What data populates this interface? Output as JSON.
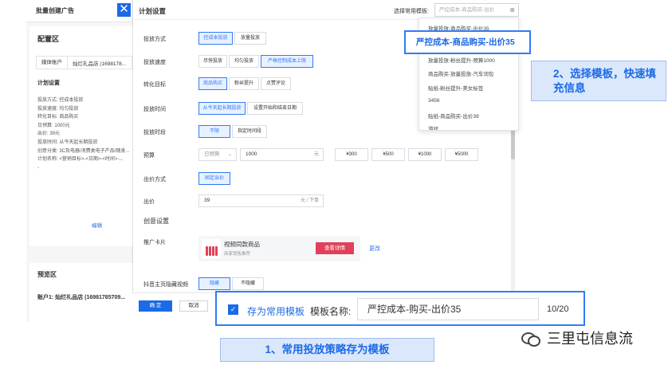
{
  "left_panel": {
    "header": "批量创建广告",
    "close_glyph": "✕",
    "config_title": "配置区",
    "account_tag": "媒体账户",
    "account_name": "灿烂礼品店 (1698178...",
    "plan_title": "计划设置",
    "plan_lines": [
      "投放方式:  控成本投放",
      "投放速度:  均匀投放",
      "转化目标:  商品购买",
      "日预算:  1000元",
      "出价:  39元",
      "投放时间:  从今天起长期投放",
      "创意分类:  3C及电器/消费类电子产品/随身...",
      "计划名称:  <营销目标>-<日期>-<时间>-...",
      "-"
    ],
    "edit_label": "编辑",
    "preview_title": "预览区",
    "preview_account": "账户1: 灿烂礼品店 (16981785709..."
  },
  "main": {
    "title": "计划设置",
    "template_label": "选择常用模板:",
    "template_placeholder": "严控成本-商品购买-出价",
    "rows": {
      "mode_label": "投放方式",
      "mode_opts": [
        "控成本投放",
        "放量投放"
      ],
      "speed_label": "投放速度",
      "speed_opts": [
        "尽快投放",
        "均匀投放",
        "严格控制成本上限"
      ],
      "target_label": "转化目标",
      "target_opts": [
        "商品购买",
        "粉丝提升",
        "点赞评论"
      ],
      "time_label": "投放时间",
      "time_opts": [
        "从今天起长期投放",
        "设置开始和结束日期"
      ],
      "slot_label": "投放时段",
      "slot_opts": [
        "不限",
        "指定时间段"
      ],
      "budget_label": "预算",
      "budget_type": "日预算",
      "budget_value": "1000",
      "budget_unit": "元",
      "budget_quick": [
        "¥300",
        "¥500",
        "¥1000",
        "¥5000"
      ],
      "bid_mode_label": "出价方式",
      "bid_mode_opt": "固定出价",
      "bid_label": "出价",
      "bid_value": "39",
      "bid_unit": "元 / 下单",
      "creative_section": "创意设置",
      "promo_label": "推广卡片",
      "product_name": "视频同款商品",
      "product_sub": "商家销售推荐",
      "product_btn": "查看详情",
      "change_link": "更改",
      "douyin_label": "抖音主页隐藏视频",
      "douyin_opts": [
        "隐藏",
        "不隐藏"
      ]
    },
    "ok_label": "确 定",
    "cancel_label": "取消"
  },
  "dropdown": {
    "items": [
      "放量投放-商品购买-出价35",
      "放量投放-粉丝提升-预算1000",
      "商品购买-放量投放-汽车词包",
      "贴纸-粉丝提升-美女标签",
      "3456",
      "贴纸-商品购买-出价39",
      "游戏"
    ],
    "highlighted": "严控成本-商品购买-出价35"
  },
  "save_strip": {
    "checkbox_glyph": "✓",
    "label": "存为常用模板",
    "name_label": "模板名称:",
    "name_value": "严控成本-购买-出价35",
    "count": "10/20"
  },
  "callouts": {
    "step2": "2、选择模板，快速填充信息",
    "step1": "1、常用投放策略存为模板"
  },
  "watermark": "三里屯信息流",
  "colors": {
    "accent": "#1b6ae8",
    "highlight_border": "#2f7cf6",
    "callout_bg": "#dbe8fb",
    "product_button": "#e2405a"
  }
}
